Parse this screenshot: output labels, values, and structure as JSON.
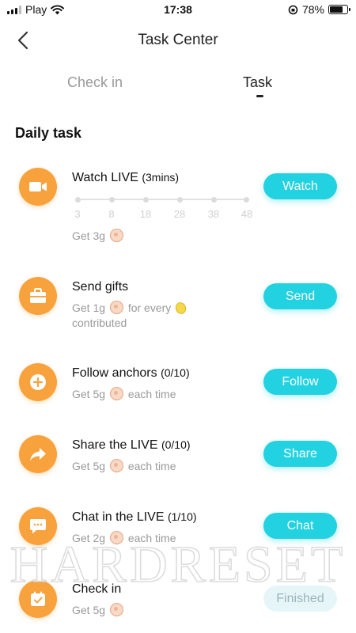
{
  "status_bar": {
    "carrier": "Play",
    "time": "17:38",
    "battery": "78%",
    "battery_level": 0.78
  },
  "header": {
    "title": "Task Center",
    "back_icon": "chevron-left-icon"
  },
  "tabs": [
    {
      "label": "Check in",
      "active": false
    },
    {
      "label": "Task",
      "active": true
    }
  ],
  "section_title": "Daily task",
  "tasks": [
    {
      "title": "Watch LIVE",
      "count": "(3mins)",
      "sub1": "Get 3g",
      "sub2": "",
      "sub3": "",
      "button": "Watch",
      "icon": "video-camera-icon",
      "progress_ticks": [
        "3",
        "8",
        "18",
        "28",
        "38",
        "48"
      ]
    },
    {
      "title": "Send gifts",
      "count": "",
      "sub1": "Get 1g",
      "sub2": "for every",
      "sub3": "contributed",
      "button": "Send",
      "icon": "gift-box-icon"
    },
    {
      "title": "Follow anchors",
      "count": "(0/10)",
      "sub1": "Get 5g",
      "sub2": "each time",
      "sub3": "",
      "button": "Follow",
      "icon": "plus-circle-icon"
    },
    {
      "title": "Share the LIVE",
      "count": "(0/10)",
      "sub1": "Get 5g",
      "sub2": "each time",
      "sub3": "",
      "button": "Share",
      "icon": "share-arrow-icon"
    },
    {
      "title": "Chat in the LIVE",
      "count": "(1/10)",
      "sub1": "Get 2g",
      "sub2": "each time",
      "sub3": "",
      "button": "Chat",
      "icon": "chat-bubble-icon"
    },
    {
      "title": "Check in",
      "count": "",
      "sub1": "Get 5g",
      "sub2": "",
      "sub3": "",
      "button": "Finished",
      "icon": "calendar-check-icon"
    }
  ],
  "watermark": "HARDRESET",
  "colors": {
    "accent": "#23d2e0",
    "icon_bg": "#f8a23d",
    "muted_text": "#9a9a9a"
  }
}
